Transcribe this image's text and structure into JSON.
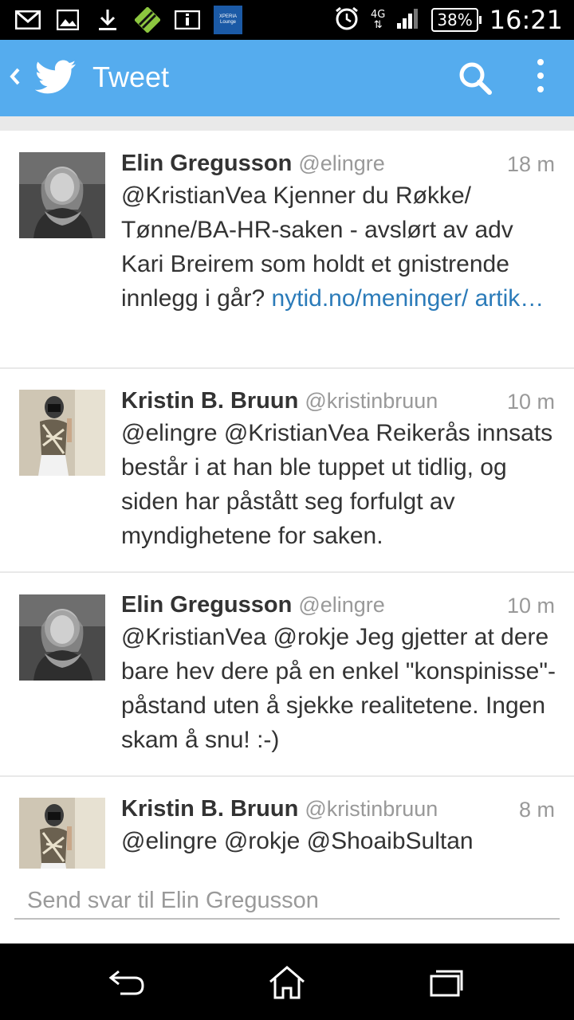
{
  "status_bar": {
    "network": "4G",
    "battery": "38%",
    "clock": "16:21",
    "xperia_label_1": "XPERIA",
    "xperia_label_2": "Lounge"
  },
  "action_bar": {
    "title": "Tweet",
    "color": "#55acee"
  },
  "tweets": [
    {
      "name": "Elin Gregusson",
      "handle": "@elingre",
      "time": "18 m",
      "text": "@KristianVea Kjenner du Røkke/ Tønne/BA-HR-saken - avslørt av adv Kari Breirem som holdt et gnistrende innlegg i går? ",
      "link": "nytid.no/meninger/ artik…",
      "avatar": "woman-with-scarf-photo"
    },
    {
      "name": "Kristin B. Bruun",
      "handle": "@kristinbruun",
      "time": "10 m",
      "text": "@elingre @KristianVea Reikerås innsats består i at han ble tuppet ut tidlig, og siden har påstått seg forfulgt av myndighetene for saken.",
      "avatar": "mirror-selfie-photo"
    },
    {
      "name": "Elin Gregusson",
      "handle": "@elingre",
      "time": "10 m",
      "text": "@KristianVea @rokje Jeg gjetter at dere bare hev dere på en enkel \"konspinisse\"-påstand uten å sjekke realitetene. Ingen skam å snu! :-)",
      "avatar": "woman-with-scarf-photo"
    },
    {
      "name": "Kristin B. Bruun",
      "handle": "@kristinbruun",
      "time": "8 m",
      "text": "@elingre @rokje @ShoaibSultan",
      "avatar": "mirror-selfie-photo"
    }
  ],
  "reply": {
    "placeholder": "Send svar til Elin Gregusson"
  }
}
